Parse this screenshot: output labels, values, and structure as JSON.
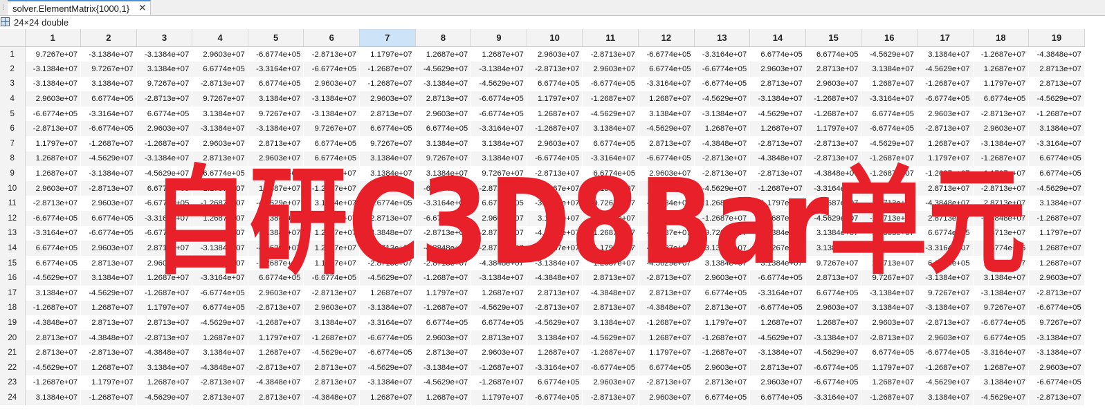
{
  "tab": {
    "title": "solver.ElementMatrix{1000,1}",
    "close_glyph": "✕",
    "grip_glyph": "⋮"
  },
  "info": {
    "size_label": "24×24 double",
    "icon": "grid-icon"
  },
  "watermark": {
    "text": "自研C3D8Bar单元",
    "color": "#e8202a"
  },
  "table": {
    "selected_column": "7",
    "columns": [
      "1",
      "2",
      "3",
      "4",
      "5",
      "6",
      "7",
      "8",
      "9",
      "10",
      "11",
      "12",
      "13",
      "14",
      "15",
      "16",
      "17",
      "18",
      "19"
    ],
    "row_labels": [
      "1",
      "2",
      "3",
      "4",
      "5",
      "6",
      "7",
      "8",
      "9",
      "10",
      "11",
      "12",
      "13",
      "14",
      "15",
      "16",
      "17",
      "18",
      "19",
      "20",
      "21",
      "22",
      "23",
      "24"
    ],
    "rows": [
      [
        "9.7267e+07",
        "-3.1384e+07",
        "-3.1384e+07",
        "2.9603e+07",
        "-6.6774e+05",
        "-2.8713e+07",
        "1.1797e+07",
        "1.2687e+07",
        "1.2687e+07",
        "2.9603e+07",
        "-2.8713e+07",
        "-6.6774e+05",
        "-3.3164e+07",
        "6.6774e+05",
        "6.6774e+05",
        "-4.5629e+07",
        "3.1384e+07",
        "-1.2687e+07",
        "-4.3848e+07"
      ],
      [
        "-3.1384e+07",
        "9.7267e+07",
        "3.1384e+07",
        "6.6774e+05",
        "-3.3164e+07",
        "-6.6774e+05",
        "-1.2687e+07",
        "-4.5629e+07",
        "-3.1384e+07",
        "-2.8713e+07",
        "2.9603e+07",
        "6.6774e+05",
        "-6.6774e+05",
        "2.9603e+07",
        "2.8713e+07",
        "3.1384e+07",
        "-4.5629e+07",
        "1.2687e+07",
        "2.8713e+07"
      ],
      [
        "-3.1384e+07",
        "3.1384e+07",
        "9.7267e+07",
        "-2.8713e+07",
        "6.6774e+05",
        "2.9603e+07",
        "-1.2687e+07",
        "-3.1384e+07",
        "-4.5629e+07",
        "6.6774e+05",
        "-6.6774e+05",
        "-3.3164e+07",
        "-6.6774e+05",
        "2.8713e+07",
        "2.9603e+07",
        "1.2687e+07",
        "-1.2687e+07",
        "1.1797e+07",
        "2.8713e+07"
      ],
      [
        "2.9603e+07",
        "6.6774e+05",
        "-2.8713e+07",
        "9.7267e+07",
        "3.1384e+07",
        "-3.1384e+07",
        "2.9603e+07",
        "2.8713e+07",
        "-6.6774e+05",
        "1.1797e+07",
        "-1.2687e+07",
        "1.2687e+07",
        "-4.5629e+07",
        "-3.1384e+07",
        "-1.2687e+07",
        "-3.3164e+07",
        "-6.6774e+05",
        "6.6774e+05",
        "-4.5629e+07"
      ],
      [
        "-6.6774e+05",
        "-3.3164e+07",
        "6.6774e+05",
        "3.1384e+07",
        "9.7267e+07",
        "-3.1384e+07",
        "2.8713e+07",
        "2.9603e+07",
        "-6.6774e+05",
        "1.2687e+07",
        "-4.5629e+07",
        "3.1384e+07",
        "-3.1384e+07",
        "-4.5629e+07",
        "-1.2687e+07",
        "6.6774e+05",
        "2.9603e+07",
        "-2.8713e+07",
        "-1.2687e+07"
      ],
      [
        "-2.8713e+07",
        "-6.6774e+05",
        "2.9603e+07",
        "-3.1384e+07",
        "-3.1384e+07",
        "9.7267e+07",
        "6.6774e+05",
        "6.6774e+05",
        "-3.3164e+07",
        "-1.2687e+07",
        "3.1384e+07",
        "-4.5629e+07",
        "1.2687e+07",
        "1.2687e+07",
        "1.1797e+07",
        "-6.6774e+05",
        "-2.8713e+07",
        "2.9603e+07",
        "3.1384e+07"
      ],
      [
        "1.1797e+07",
        "-1.2687e+07",
        "-1.2687e+07",
        "2.9603e+07",
        "2.8713e+07",
        "6.6774e+05",
        "9.7267e+07",
        "3.1384e+07",
        "3.1384e+07",
        "2.9603e+07",
        "6.6774e+05",
        "2.8713e+07",
        "-4.3848e+07",
        "-2.8713e+07",
        "-2.8713e+07",
        "-4.5629e+07",
        "1.2687e+07",
        "-3.1384e+07",
        "-3.3164e+07"
      ],
      [
        "1.2687e+07",
        "-4.5629e+07",
        "-3.1384e+07",
        "2.8713e+07",
        "2.9603e+07",
        "6.6774e+05",
        "3.1384e+07",
        "9.7267e+07",
        "3.1384e+07",
        "-6.6774e+05",
        "-3.3164e+07",
        "-6.6774e+05",
        "-2.8713e+07",
        "-4.3848e+07",
        "-2.8713e+07",
        "-1.2687e+07",
        "1.1797e+07",
        "-1.2687e+07",
        "6.6774e+05"
      ],
      [
        "1.2687e+07",
        "-3.1384e+07",
        "-4.5629e+07",
        "-6.6774e+05",
        "-6.6774e+05",
        "-3.3164e+07",
        "3.1384e+07",
        "3.1384e+07",
        "9.7267e+07",
        "-2.8713e+07",
        "6.6774e+05",
        "2.9603e+07",
        "-2.8713e+07",
        "-2.8713e+07",
        "-4.3848e+07",
        "-1.2687e+07",
        "-1.2687e+07",
        "1.1797e+07",
        "6.6774e+05"
      ],
      [
        "2.9603e+07",
        "-2.8713e+07",
        "6.6774e+05",
        "1.1797e+07",
        "1.2687e+07",
        "-1.2687e+07",
        "2.9603e+07",
        "-6.6774e+05",
        "-2.8713e+07",
        "9.7267e+07",
        "-3.1384e+07",
        "3.1384e+07",
        "-4.5629e+07",
        "-1.2687e+07",
        "-3.3164e+07",
        "-4.3848e+07",
        "2.8713e+07",
        "-2.8713e+07",
        "-4.5629e+07"
      ],
      [
        "-2.8713e+07",
        "2.9603e+07",
        "-6.6774e+05",
        "-1.2687e+07",
        "-4.5629e+07",
        "3.1384e+07",
        "6.6774e+05",
        "-3.3164e+07",
        "6.6774e+05",
        "-3.1384e+07",
        "9.7267e+07",
        "-3.1384e+07",
        "1.2687e+07",
        "1.1797e+07",
        "1.2687e+07",
        "2.8713e+07",
        "-4.3848e+07",
        "2.8713e+07",
        "3.1384e+07"
      ],
      [
        "-6.6774e+05",
        "6.6774e+05",
        "-3.3164e+07",
        "1.2687e+07",
        "3.1384e+07",
        "-4.5629e+07",
        "2.8713e+07",
        "-6.6774e+05",
        "2.9603e+07",
        "3.1384e+07",
        "-3.1384e+07",
        "9.7267e+07",
        "-1.2687e+07",
        "-1.2687e+07",
        "-4.5629e+07",
        "-2.8713e+07",
        "2.8713e+07",
        "-4.3848e+07",
        "-1.2687e+07"
      ],
      [
        "-3.3164e+07",
        "-6.6774e+05",
        "-6.6774e+05",
        "-4.5629e+07",
        "-3.1384e+07",
        "1.2687e+07",
        "-4.3848e+07",
        "-2.8713e+07",
        "-2.8713e+07",
        "-4.5629e+07",
        "1.2687e+07",
        "-1.2687e+07",
        "9.7267e+07",
        "3.1384e+07",
        "3.1384e+07",
        "2.9603e+07",
        "6.6774e+05",
        "2.8713e+07",
        "1.1797e+07"
      ],
      [
        "6.6774e+05",
        "2.9603e+07",
        "2.8713e+07",
        "-3.1384e+07",
        "-4.5629e+07",
        "1.2687e+07",
        "-2.8713e+07",
        "-4.3848e+07",
        "-2.8713e+07",
        "-1.2687e+07",
        "1.1797e+07",
        "-1.2687e+07",
        "3.1384e+07",
        "9.7267e+07",
        "3.1384e+07",
        "-6.6774e+05",
        "-3.3164e+07",
        "6.6774e+05",
        "1.2687e+07"
      ],
      [
        "6.6774e+05",
        "2.8713e+07",
        "2.9603e+07",
        "-1.2687e+07",
        "-1.2687e+07",
        "1.1797e+07",
        "-2.8713e+07",
        "-2.8713e+07",
        "-4.3848e+07",
        "-3.1384e+07",
        "1.2687e+07",
        "-4.5629e+07",
        "3.1384e+07",
        "3.1384e+07",
        "9.7267e+07",
        "2.8713e+07",
        "6.6774e+05",
        "2.9603e+07",
        "1.2687e+07"
      ],
      [
        "-4.5629e+07",
        "3.1384e+07",
        "1.2687e+07",
        "-3.3164e+07",
        "6.6774e+05",
        "-6.6774e+05",
        "-4.5629e+07",
        "-1.2687e+07",
        "-3.1384e+07",
        "-4.3848e+07",
        "2.8713e+07",
        "-2.8713e+07",
        "2.9603e+07",
        "-6.6774e+05",
        "2.8713e+07",
        "9.7267e+07",
        "-3.1384e+07",
        "3.1384e+07",
        "2.9603e+07"
      ],
      [
        "3.1384e+07",
        "-4.5629e+07",
        "-1.2687e+07",
        "-6.6774e+05",
        "2.9603e+07",
        "-2.8713e+07",
        "1.2687e+07",
        "1.1797e+07",
        "1.2687e+07",
        "2.8713e+07",
        "-4.3848e+07",
        "2.8713e+07",
        "6.6774e+05",
        "-3.3164e+07",
        "6.6774e+05",
        "-3.1384e+07",
        "9.7267e+07",
        "-3.1384e+07",
        "-2.8713e+07"
      ],
      [
        "-1.2687e+07",
        "1.2687e+07",
        "1.1797e+07",
        "6.6774e+05",
        "-2.8713e+07",
        "2.9603e+07",
        "-3.1384e+07",
        "-1.2687e+07",
        "-4.5629e+07",
        "-2.8713e+07",
        "2.8713e+07",
        "-4.3848e+07",
        "2.8713e+07",
        "-6.6774e+05",
        "2.9603e+07",
        "3.1384e+07",
        "-3.1384e+07",
        "9.7267e+07",
        "-6.6774e+05"
      ],
      [
        "-4.3848e+07",
        "2.8713e+07",
        "2.8713e+07",
        "-4.5629e+07",
        "-1.2687e+07",
        "3.1384e+07",
        "-3.3164e+07",
        "6.6774e+05",
        "6.6774e+05",
        "-4.5629e+07",
        "3.1384e+07",
        "-1.2687e+07",
        "1.1797e+07",
        "1.2687e+07",
        "1.2687e+07",
        "2.9603e+07",
        "-2.8713e+07",
        "-6.6774e+05",
        "9.7267e+07"
      ],
      [
        "2.8713e+07",
        "-4.3848e+07",
        "-2.8713e+07",
        "1.2687e+07",
        "1.1797e+07",
        "-1.2687e+07",
        "-6.6774e+05",
        "2.9603e+07",
        "2.8713e+07",
        "3.1384e+07",
        "-4.5629e+07",
        "1.2687e+07",
        "-1.2687e+07",
        "-4.5629e+07",
        "-3.1384e+07",
        "-2.8713e+07",
        "2.9603e+07",
        "6.6774e+05",
        "-3.1384e+07"
      ],
      [
        "2.8713e+07",
        "-2.8713e+07",
        "-4.3848e+07",
        "3.1384e+07",
        "1.2687e+07",
        "-4.5629e+07",
        "-6.6774e+05",
        "2.8713e+07",
        "2.9603e+07",
        "1.2687e+07",
        "-1.2687e+07",
        "1.1797e+07",
        "-1.2687e+07",
        "-3.1384e+07",
        "-4.5629e+07",
        "6.6774e+05",
        "-6.6774e+05",
        "-3.3164e+07",
        "-3.1384e+07"
      ],
      [
        "-4.5629e+07",
        "1.2687e+07",
        "3.1384e+07",
        "-4.3848e+07",
        "-2.8713e+07",
        "2.8713e+07",
        "-4.5629e+07",
        "-3.1384e+07",
        "-1.2687e+07",
        "-3.3164e+07",
        "-6.6774e+05",
        "6.6774e+05",
        "2.9603e+07",
        "2.8713e+07",
        "-6.6774e+05",
        "1.1797e+07",
        "-1.2687e+07",
        "1.2687e+07",
        "2.9603e+07"
      ],
      [
        "-1.2687e+07",
        "1.1797e+07",
        "1.2687e+07",
        "-2.8713e+07",
        "-4.3848e+07",
        "2.8713e+07",
        "-3.1384e+07",
        "-4.5629e+07",
        "-1.2687e+07",
        "6.6774e+05",
        "2.9603e+07",
        "-2.8713e+07",
        "2.8713e+07",
        "2.9603e+07",
        "-6.6774e+05",
        "1.2687e+07",
        "-4.5629e+07",
        "3.1384e+07",
        "-6.6774e+05"
      ],
      [
        "3.1384e+07",
        "-1.2687e+07",
        "-4.5629e+07",
        "2.8713e+07",
        "2.8713e+07",
        "-4.3848e+07",
        "1.2687e+07",
        "1.2687e+07",
        "1.1797e+07",
        "-6.6774e+05",
        "-2.8713e+07",
        "2.9603e+07",
        "6.6774e+05",
        "6.6774e+05",
        "-3.3164e+07",
        "-1.2687e+07",
        "3.1384e+07",
        "-4.5629e+07",
        "-2.8713e+07"
      ]
    ]
  }
}
